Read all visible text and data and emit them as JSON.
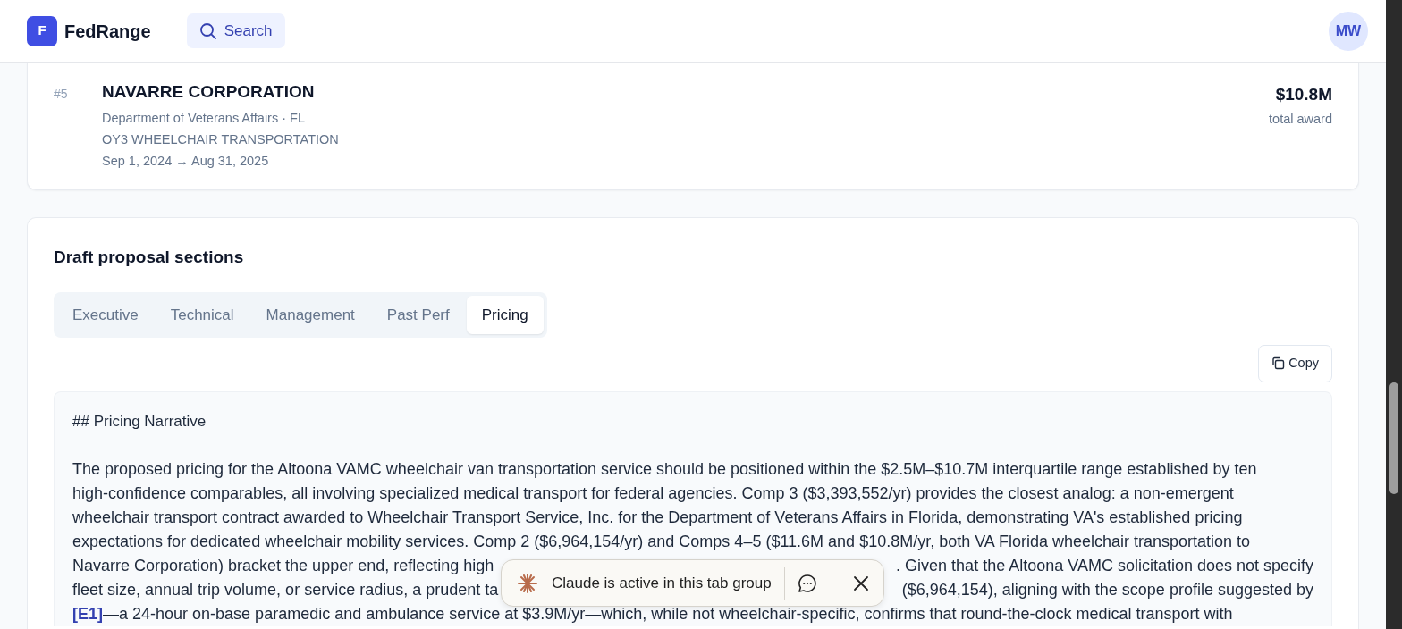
{
  "header": {
    "logo_letter": "F",
    "brand": "FedRange",
    "search_label": "Search",
    "avatar_initials": "MW"
  },
  "award": {
    "rank": "#5",
    "name": "NAVARRE CORPORATION",
    "agency": "Department of Veterans Affairs · FL",
    "title": "OY3 WHEELCHAIR TRANSPORTATION",
    "period": "Sep 1, 2024 → Aug 31, 2025",
    "amount": "$10.8M",
    "amount_label": "total award"
  },
  "draft": {
    "title": "Draft proposal sections",
    "tabs": [
      {
        "label": "Executive",
        "selected": false
      },
      {
        "label": "Technical",
        "selected": false
      },
      {
        "label": "Management",
        "selected": false
      },
      {
        "label": "Past Perf",
        "selected": false
      },
      {
        "label": "Pricing",
        "selected": true
      }
    ],
    "copy_label": "Copy",
    "heading": "## Pricing Narrative",
    "lines": [
      {
        "kind": "full",
        "text": "The proposed pricing for the Altoona VAMC wheelchair van transportation service should be positioned within the $2.5M–$10.7M interquartile range established by ten"
      },
      {
        "kind": "full",
        "text": "high-confidence comparables, all involving specialized medical transport for federal agencies. Comp 3 ($3,393,552/yr) provides the closest analog: a non-emergent"
      },
      {
        "kind": "full",
        "text": "wheelchair transport contract awarded to Wheelchair Transport Service, Inc. for the Department of Veterans Affairs in Florida, demonstrating VA's established pricing"
      },
      {
        "kind": "full",
        "text": "expectations for dedicated wheelchair mobility services. Comp 2 ($6,964,154/yr) and Comps 4–5 ($11.6M and $10.8M/yr, both VA Florida wheelchair transportation to"
      },
      {
        "kind": "split",
        "left": "Navarre Corporation) bracket the upper end, reflecting high",
        "right": ". Given that the Altoona VAMC solicitation does not specify"
      },
      {
        "kind": "split",
        "left": "fleet size, annual trip volume, or service radius, a prudent ta",
        "right": "($6,964,154), aligning with the scope profile suggested by"
      },
      {
        "kind": "cited",
        "link": "[E1]",
        "text": "—a 24-hour on-base paramedic and ambulance service at $3.9M/yr—which, while not wheelchair-specific, confirms that round-the-clock medical transport with"
      }
    ]
  },
  "toast": {
    "text": "Claude is active in this tab group"
  }
}
